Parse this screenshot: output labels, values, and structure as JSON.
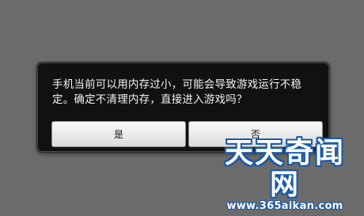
{
  "dialog": {
    "message": "手机当前可以用内存过小，可能会导致游戏运行不稳定。确定不清理内存，直接进入游戏吗？",
    "buttons": {
      "yes_label": "是",
      "no_label": "否"
    }
  },
  "watermark": {
    "logo_text": "天天奇闻网",
    "url": "www.365aikan.com"
  },
  "colors": {
    "background": "#6b6b6b",
    "dialog_bg": "#111111",
    "watermark_outline": "#1a5aa6"
  }
}
